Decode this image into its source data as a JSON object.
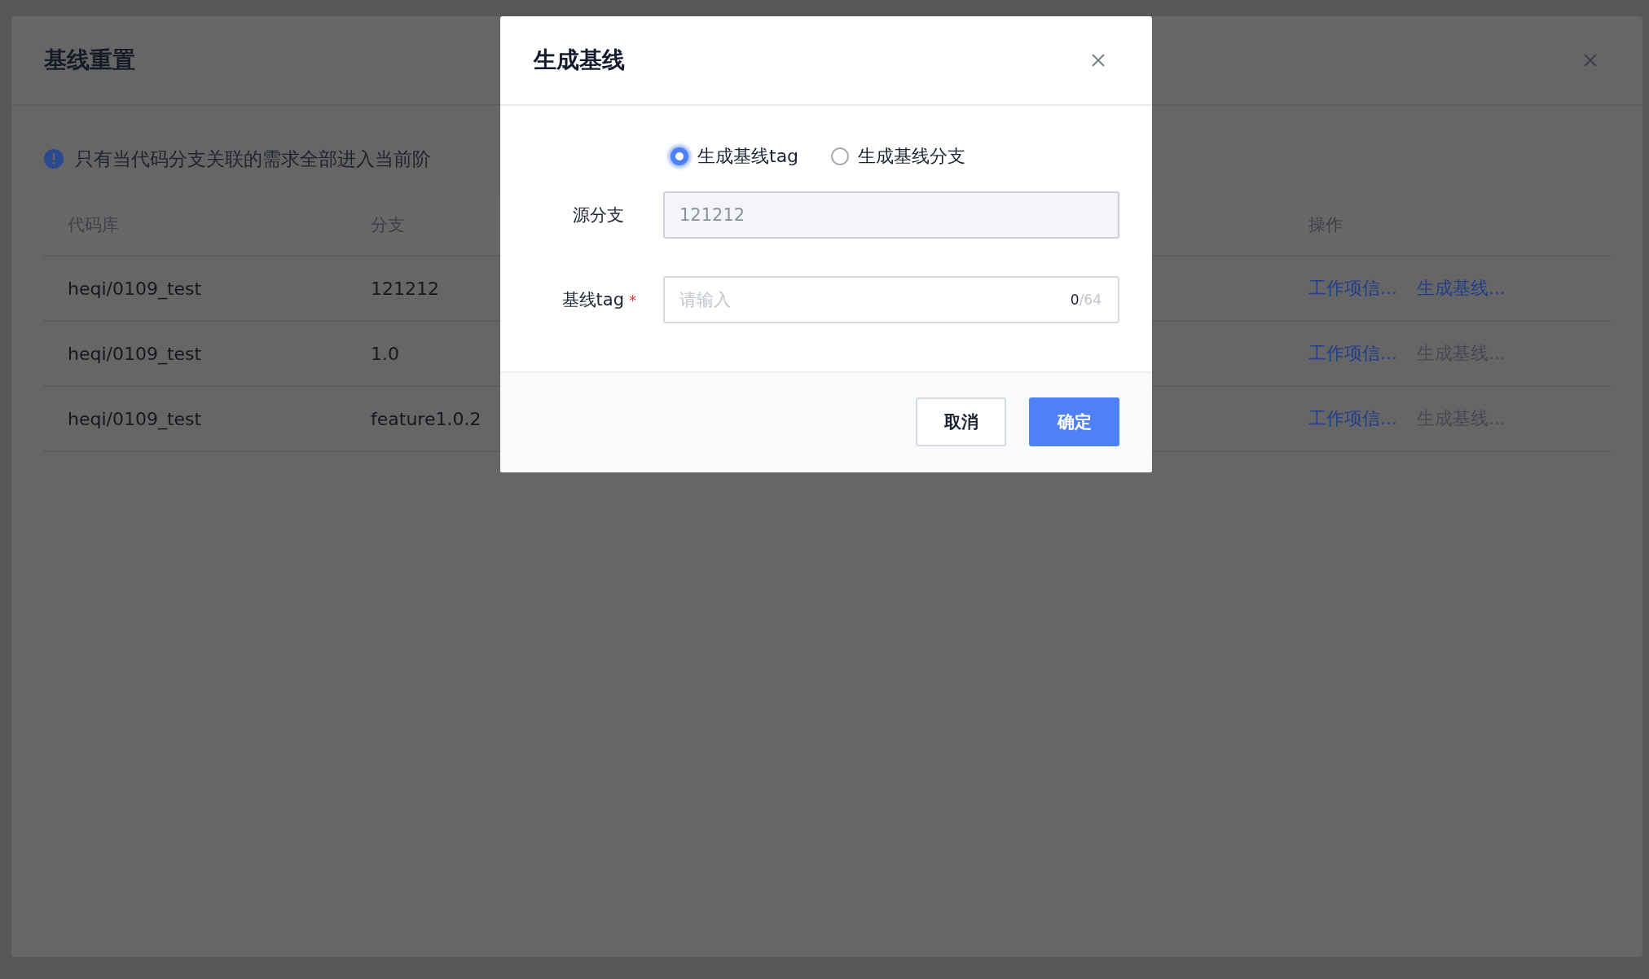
{
  "drawer": {
    "title": "基线重置",
    "notice": "只有当代码分支关联的需求全部进入当前阶",
    "table": {
      "columns": [
        {
          "label": "代码库",
          "kind": "text"
        },
        {
          "label": "分支",
          "kind": "text"
        },
        {
          "label": "操作",
          "kind": "actions"
        }
      ],
      "rows": [
        {
          "cells": [
            "heqi/0109_test",
            "121212"
          ],
          "actions": [
            {
              "label": "工作项信...",
              "disabled": false
            },
            {
              "label": "生成基线...",
              "disabled": false
            }
          ]
        },
        {
          "cells": [
            "heqi/0109_test",
            "1.0"
          ],
          "actions": [
            {
              "label": "工作项信...",
              "disabled": false
            },
            {
              "label": "生成基线...",
              "disabled": true
            }
          ]
        },
        {
          "cells": [
            "heqi/0109_test",
            "feature1.0.2"
          ],
          "actions": [
            {
              "label": "工作项信...",
              "disabled": false
            },
            {
              "label": "生成基线...",
              "disabled": true
            }
          ]
        }
      ]
    }
  },
  "dialog": {
    "title": "生成基线",
    "options": [
      {
        "label": "生成基线tag",
        "selected": true
      },
      {
        "label": "生成基线分支",
        "selected": false
      }
    ],
    "fields": [
      {
        "label": "源分支",
        "disabled": true,
        "value": "121212"
      },
      {
        "label": "基线tag",
        "required_mark": "*",
        "disabled": false,
        "placeholder": "请输入",
        "count": "0",
        "limit": "/64"
      }
    ],
    "buttons": [
      {
        "label": "取消",
        "kind": "secondary"
      },
      {
        "label": "确定",
        "kind": "primary"
      }
    ]
  }
}
